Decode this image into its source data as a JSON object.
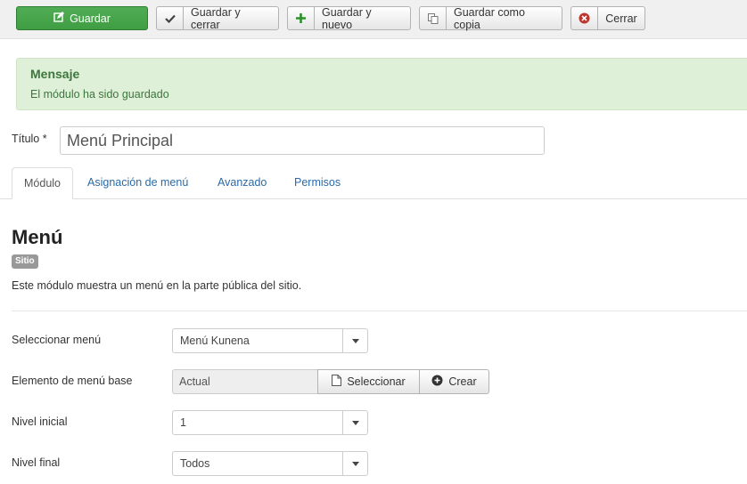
{
  "toolbar": {
    "save": "Guardar",
    "save_close": "Guardar y cerrar",
    "save_new": "Guardar y nuevo",
    "save_copy": "Guardar como copia",
    "close": "Cerrar"
  },
  "message": {
    "title": "Mensaje",
    "text": "El módulo ha sido guardado"
  },
  "form": {
    "title_label": "Título *",
    "title_value": "Menú Principal"
  },
  "tabs": [
    {
      "label": "Módulo",
      "active": true
    },
    {
      "label": "Asignación de menú",
      "active": false
    },
    {
      "label": "Avanzado",
      "active": false
    },
    {
      "label": "Permisos",
      "active": false
    }
  ],
  "module": {
    "heading": "Menú",
    "badge": "Sitio",
    "description": "Este módulo muestra un menú en la parte pública del sitio."
  },
  "fields": {
    "select_menu": {
      "label": "Seleccionar menú",
      "value": "Menú Kunena"
    },
    "base_item": {
      "label": "Elemento de menú base",
      "value": "Actual",
      "select_btn": "Seleccionar",
      "create_btn": "Crear"
    },
    "start_level": {
      "label": "Nivel inicial",
      "value": "1"
    },
    "end_level": {
      "label": "Nivel final",
      "value": "Todos"
    }
  },
  "colors": {
    "primary": "#46a546",
    "success_bg": "#dff0d8",
    "success_text": "#3c763d",
    "link": "#2a6aa8",
    "danger": "#bd362f"
  }
}
